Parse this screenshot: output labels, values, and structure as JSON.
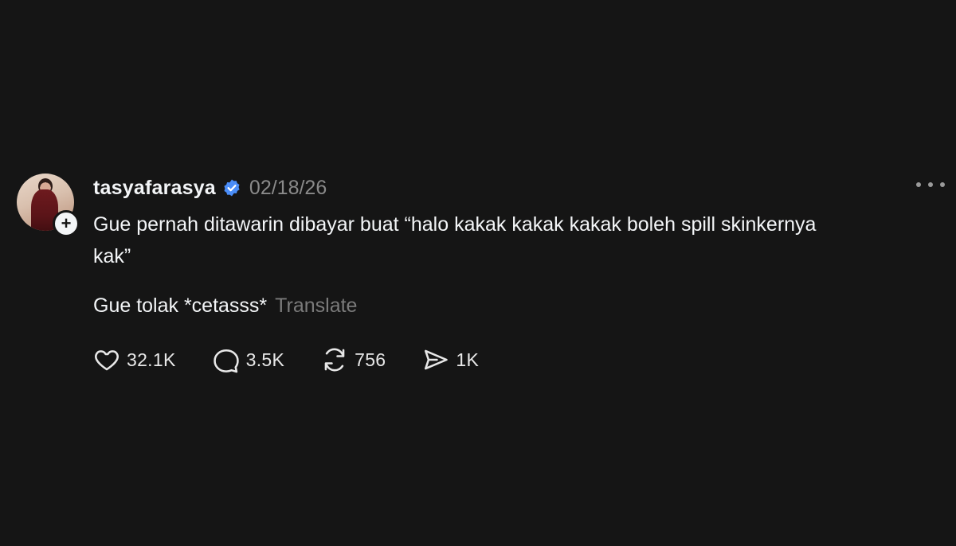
{
  "post": {
    "username": "tasyafarasya",
    "timestamp": "02/18/26",
    "text_line1": "Gue pernah ditawarin dibayar buat “halo kakak kakak kakak boleh spill skinkernya kak”",
    "text_line2": "Gue tolak *cetasss*",
    "translate_label": "Translate",
    "likes": "32.1K",
    "replies": "3.5K",
    "reposts": "756",
    "shares": "1K"
  },
  "icons": {
    "verified": "verified-badge-icon",
    "follow": "plus-icon",
    "more": "more-dots-icon",
    "like": "heart-icon",
    "reply": "comment-bubble-icon",
    "repost": "repost-icon",
    "share": "send-icon"
  },
  "colors": {
    "background": "#151515",
    "text": "#f3f5f7",
    "muted": "#8a8a8a",
    "verified": "#4a8df8"
  }
}
